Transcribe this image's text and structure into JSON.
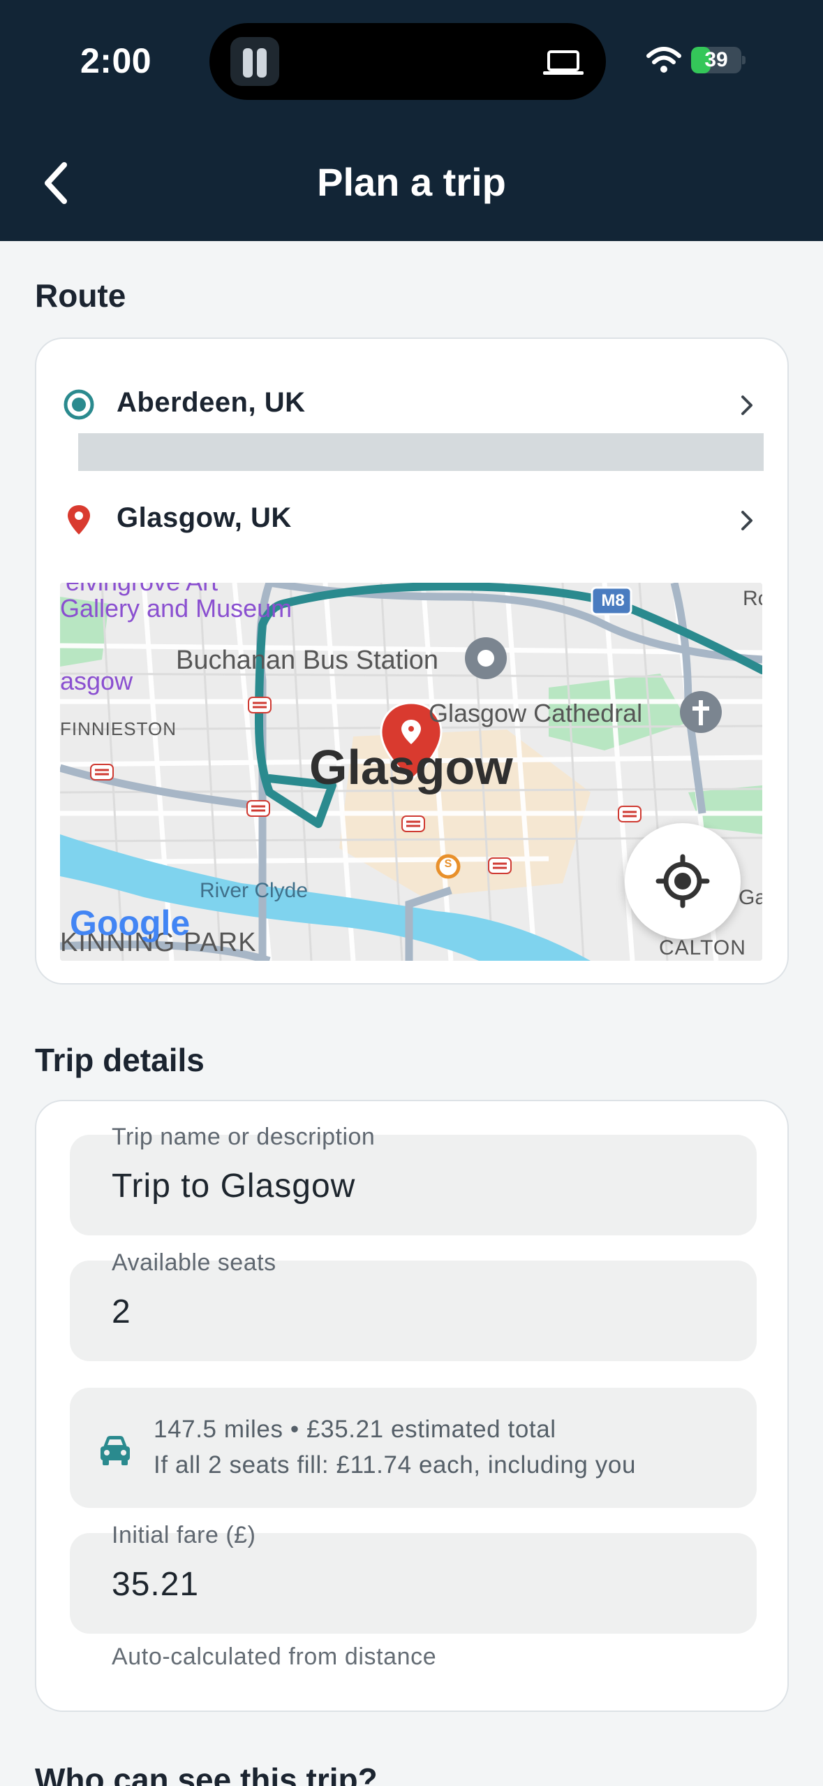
{
  "status_bar": {
    "time": "2:00",
    "battery": "39",
    "battery_level": 0.39
  },
  "header": {
    "title": "Plan a trip"
  },
  "route": {
    "section_title": "Route",
    "origin": "Aberdeen, UK",
    "destination": "Glasgow, UK",
    "map": {
      "labels": {
        "gallery_top": "elvingrove Art",
        "gallery": "Gallery and Museum",
        "bus_station": "Buchanan Bus Station",
        "glasgow_left": "asgow",
        "finnieston": "FINNIESTON",
        "cathedral": "Glasgow Cathedral",
        "city": "Glasgow",
        "motorway": "M8",
        "river": "River Clyde",
        "kinning_park": "KINNING PARK",
        "calton": "CALTON",
        "edge_right_top": "Ro",
        "edge_right": "Ga",
        "subway": "S",
        "google": "Google"
      },
      "colors": {
        "route": "#2a8a8e",
        "pin": "#d93a2f",
        "water": "#7fd3ee",
        "park": "#b8e6c2"
      }
    }
  },
  "trip": {
    "section_title": "Trip details",
    "name_label": "Trip name or description",
    "name_value": "Trip to Glasgow",
    "seats_label": "Available seats",
    "seats_value": "2",
    "estimate_line1": "147.5 miles • £35.21 estimated total",
    "estimate_line2": "If all 2 seats fill: £11.74 each, including you",
    "fare_label": "Initial fare (£)",
    "fare_value": "35.21",
    "fare_helper": "Auto-calculated from distance"
  },
  "visibility": {
    "section_title": "Who can see this trip?"
  },
  "icons": {
    "back": "chevron-left-icon",
    "origin": "radio-target-icon",
    "destination": "location-pin-icon",
    "chevron": "chevron-right-icon",
    "locate": "my-location-icon",
    "car": "car-icon"
  }
}
